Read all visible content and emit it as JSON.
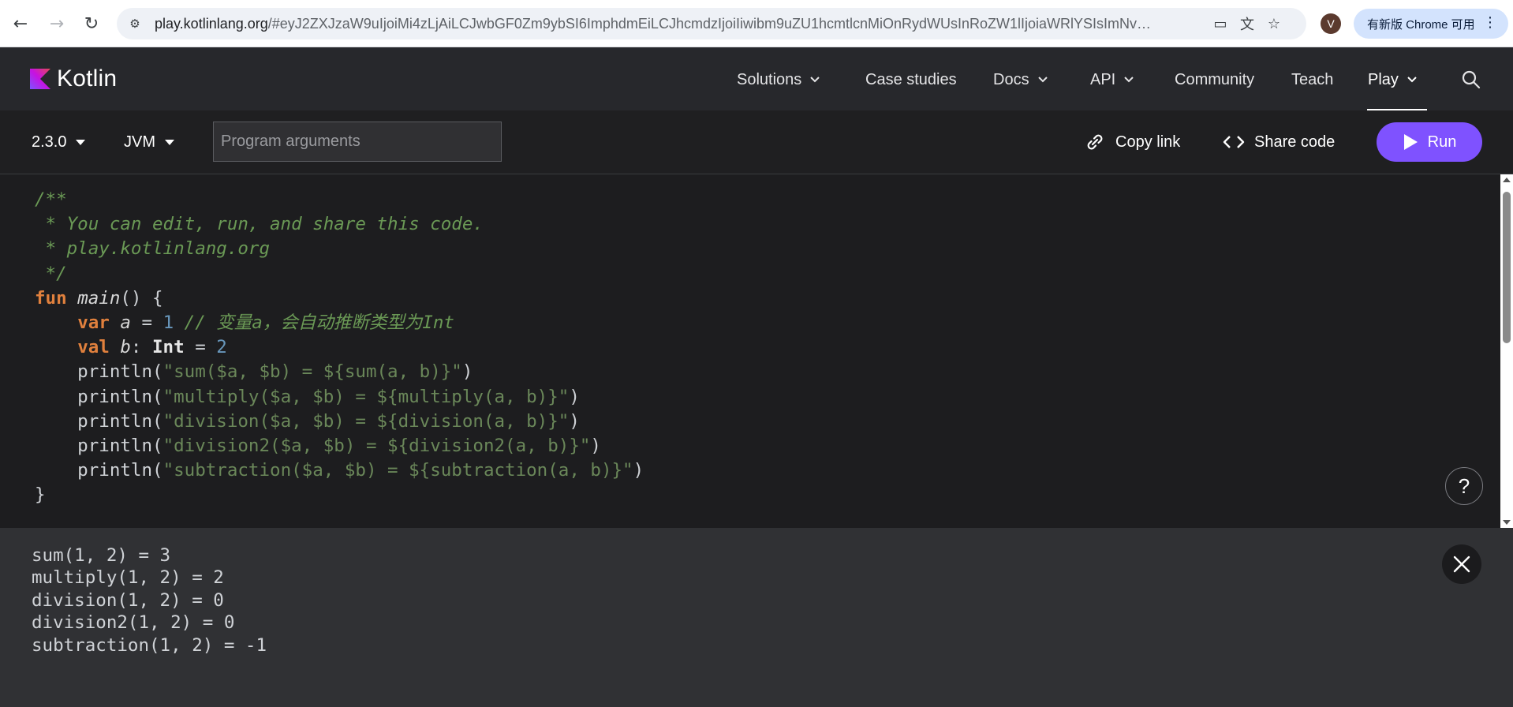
{
  "browser": {
    "url_host": "play.kotlinlang.org",
    "url_rest": "/#eyJ2ZXJzaW9uIjoiMi4zLjAiLCJwbGF0Zm9ybSI6ImphdmEiLCJhcmdzIjoiIiwibm9uZU1hcmtlcnMiOnRydWUsInRoZW1lIjoiaWRlYSIsImNvZG...",
    "profile_initial": "V",
    "update_label": "有新版 Chrome 可用"
  },
  "header": {
    "logo_text": "Kotlin",
    "nav": [
      {
        "label": "Solutions"
      },
      {
        "label": "Case studies"
      },
      {
        "label": "Docs"
      },
      {
        "label": "API"
      },
      {
        "label": "Community"
      },
      {
        "label": "Teach"
      },
      {
        "label": "Play"
      }
    ],
    "active_item": "Play",
    "accent_color": "#7f52ff"
  },
  "toolbar": {
    "version": "2.3.0",
    "platform": "JVM",
    "args_placeholder": "Program arguments",
    "args_value": "",
    "copy_link_label": "Copy link",
    "share_code_label": "Share code",
    "run_label": "Run"
  },
  "editor": {
    "lines": [
      "/**",
      " * You can edit, run, and share this code.",
      " * play.kotlinlang.org",
      " */",
      "fun main() {",
      "    var a = 1 // 变量a，会自动推断类型为Int",
      "    val b: Int = 2",
      "    println(\"sum($a, $b) = ${sum(a, b)}\")",
      "    println(\"multiply($a, $b) = ${multiply(a, b)}\")",
      "    println(\"division($a, $b) = ${division(a, b)}\")",
      "    println(\"division2($a, $b) = ${division2(a, b)}\")",
      "    println(\"subtraction($a, $b) = ${subtraction(a, b)}\")",
      "}"
    ],
    "help_label": "?"
  },
  "output": {
    "lines": [
      "sum(1, 2) = 3",
      "multiply(1, 2) = 2",
      "division(1, 2) = 0",
      "division2(1, 2) = 0",
      "subtraction(1, 2) = -1"
    ]
  }
}
